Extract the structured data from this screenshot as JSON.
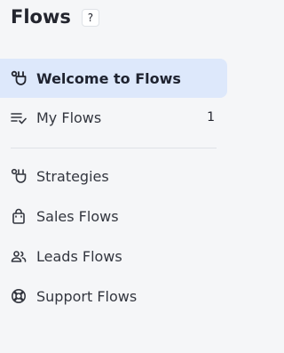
{
  "header": {
    "title": "Flows",
    "help_label": "?"
  },
  "nav": {
    "primary": [
      {
        "label": "Welcome to Flows",
        "icon": "flows-icon"
      },
      {
        "label": "My Flows",
        "icon": "checklist-icon",
        "count": "1"
      }
    ],
    "secondary": [
      {
        "label": "Strategies",
        "icon": "flows-icon"
      },
      {
        "label": "Sales Flows",
        "icon": "shopping-bag-icon"
      },
      {
        "label": "Leads Flows",
        "icon": "people-icon"
      },
      {
        "label": "Support Flows",
        "icon": "lifebuoy-icon"
      }
    ]
  },
  "colors": {
    "background": "#f5f6f8",
    "active_background": "#dde8fb",
    "text": "#23252e"
  }
}
